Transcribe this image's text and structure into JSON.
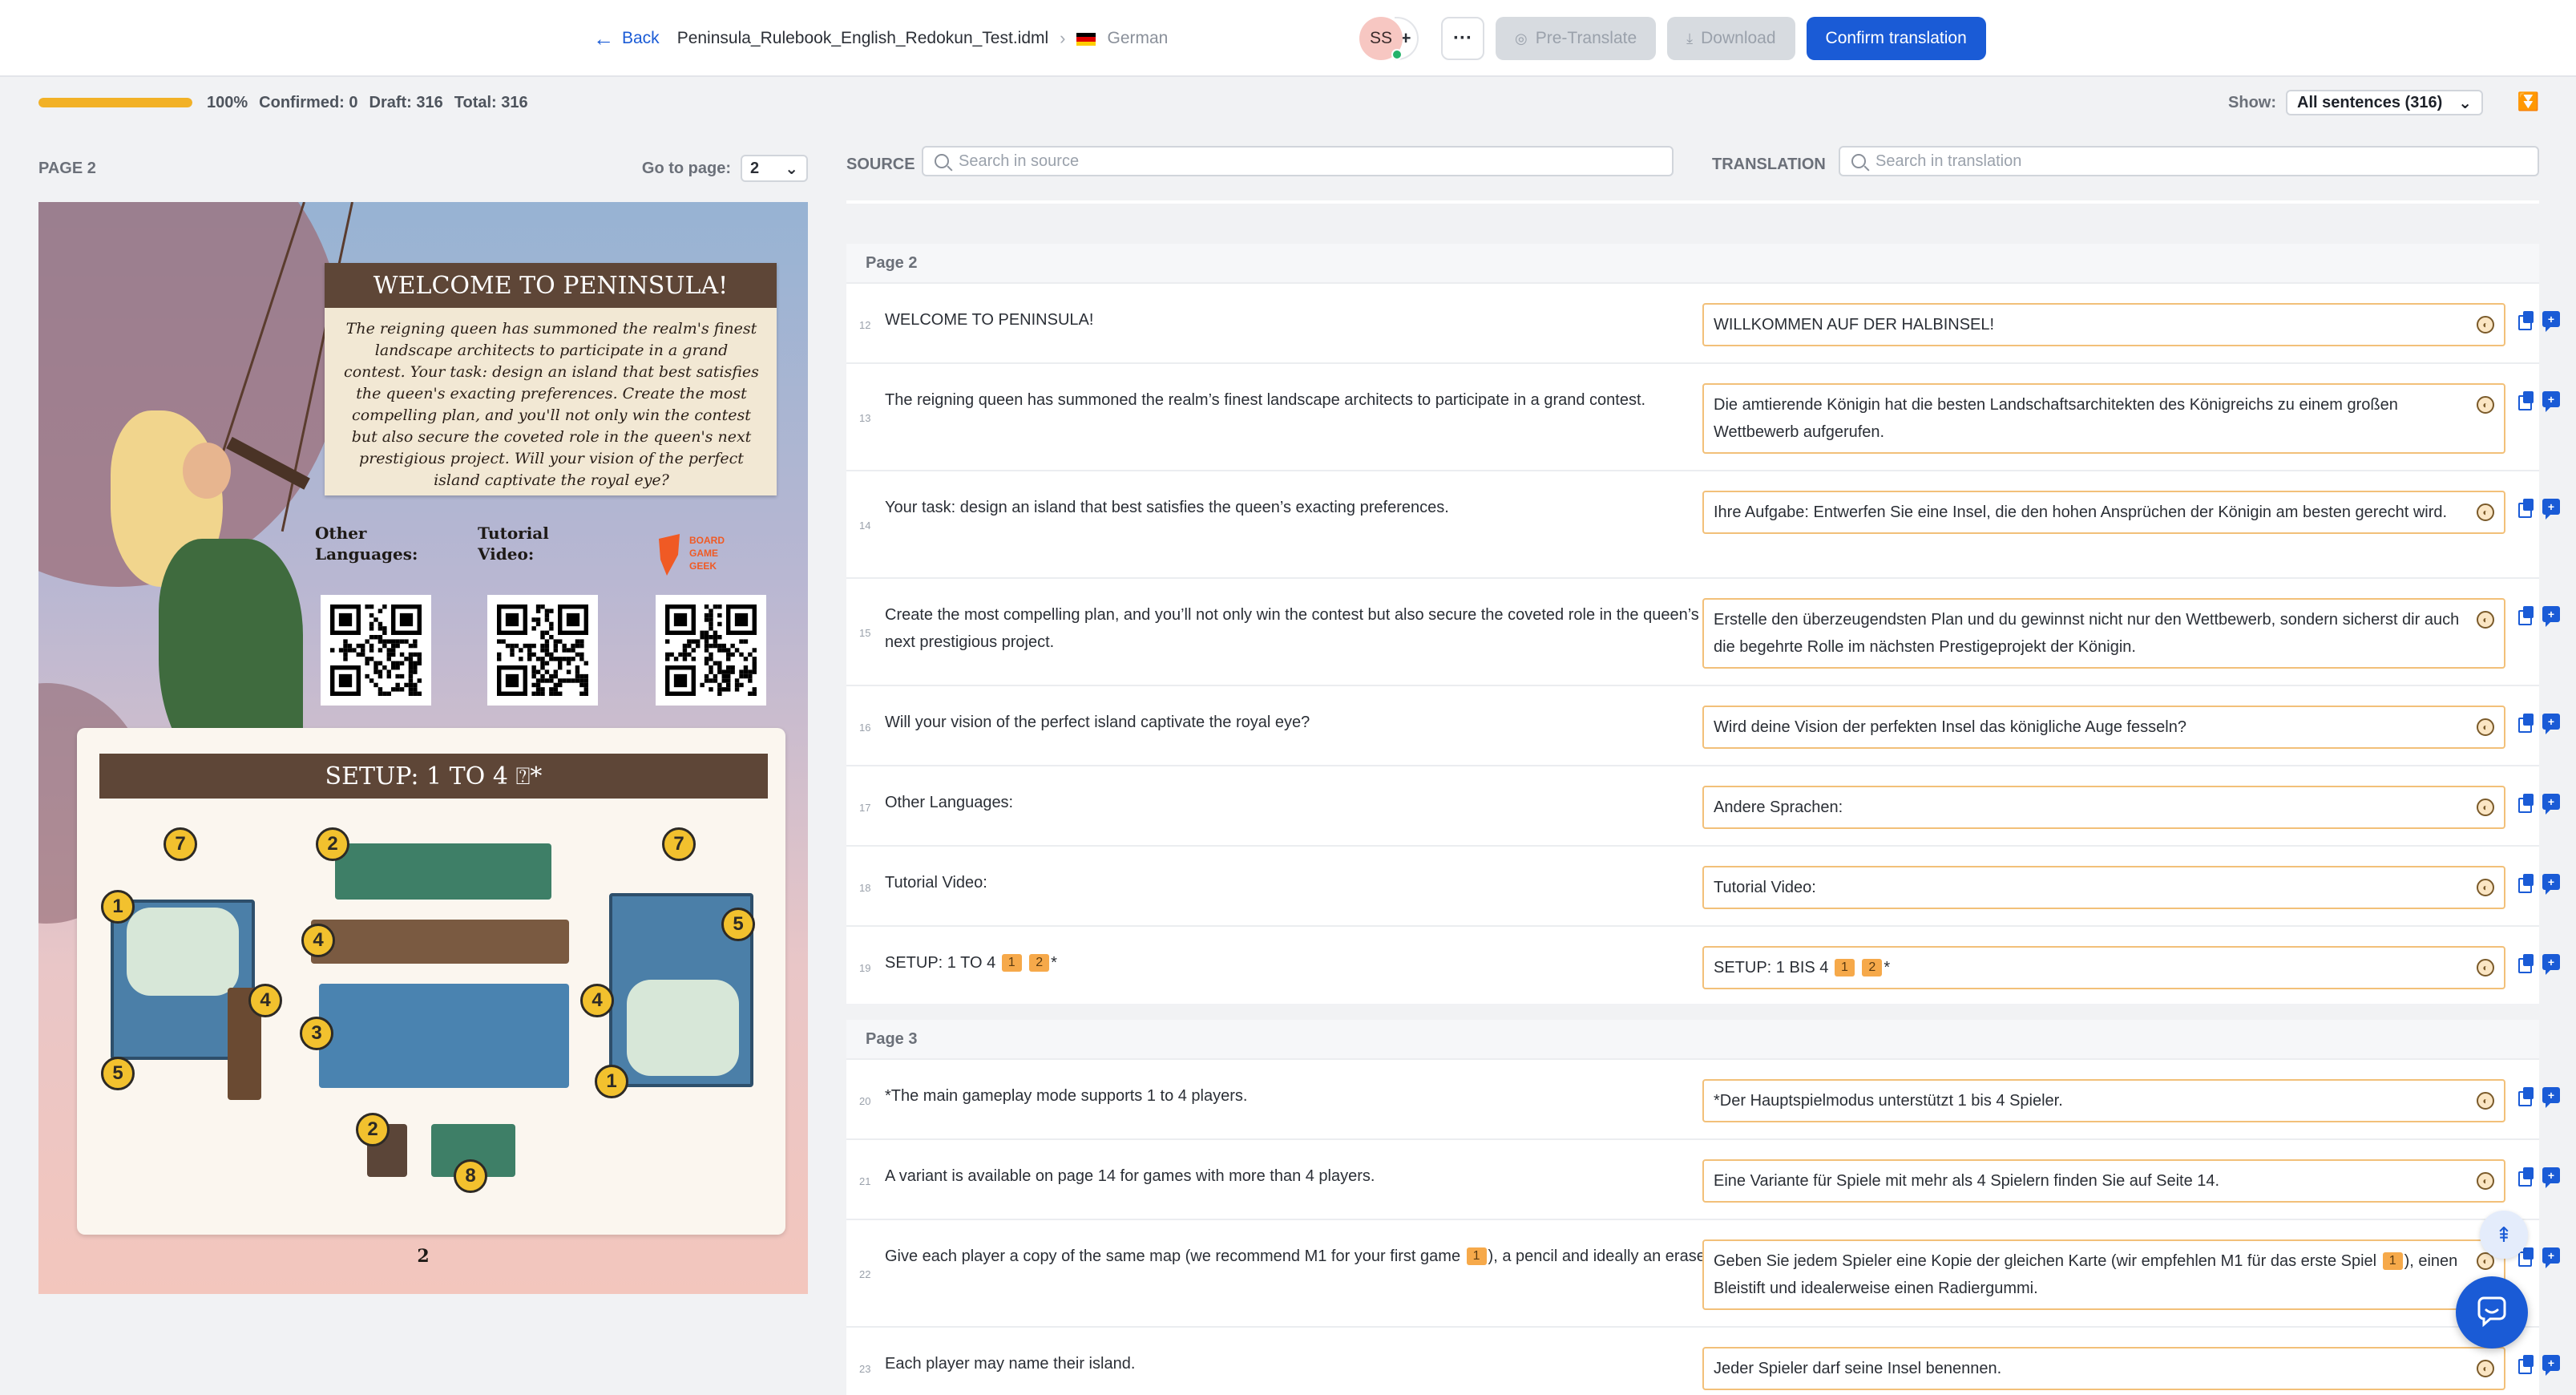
{
  "header": {
    "back_label": "Back",
    "file_name": "Peninsula_Rulebook_English_Redokun_Test.idml",
    "target_language": "German",
    "avatar_initials": "SS",
    "avatar_add": "+",
    "more_label": "···",
    "pretranslate_label": "Pre-Translate",
    "download_label": "Download",
    "confirm_label": "Confirm translation"
  },
  "progress": {
    "fraction": 1.0,
    "percent_label": "100%",
    "confirmed": "Confirmed: 0",
    "draft": "Draft: 316",
    "total": "Total: 316"
  },
  "filter": {
    "show_label": "Show:",
    "show_value": "All sentences (316)"
  },
  "left_panel": {
    "page_label": "PAGE 2",
    "goto_label": "Go to page:",
    "goto_value": "2"
  },
  "preview": {
    "welcome_title": "WELCOME TO PENINSULA!",
    "welcome_text": "The reigning queen has summoned the realm's finest landscape architects to participate in a grand contest. Your task: design an island that best satisfies the queen's exacting preferences. Create the most compelling plan, and you'll not only win the contest but also secure the coveted role in the queen's next prestigious project. Will your vision of the perfect island captivate the royal eye?",
    "other_languages": "Other Languages:",
    "tutorial_video": "Tutorial Video:",
    "bgg_logo_text": "BOARD GAME GEEK",
    "setup_title": "SETUP: 1 TO 4 ⍰*",
    "page_number": "2"
  },
  "right_panel": {
    "source_label": "SOURCE",
    "source_placeholder": "Search in source",
    "translation_label": "TRANSLATION",
    "translation_placeholder": "Search in translation"
  },
  "sections": [
    {
      "title": "Page 2",
      "rows": [
        {
          "num": "12",
          "source": "WELCOME TO PENINSULA!",
          "target": "WILLKOMMEN AUF DER HALBINSEL!"
        },
        {
          "num": "13",
          "source": "The reigning queen has summoned the realm’s finest landscape architects to participate in a grand contest.",
          "target": "Die amtierende Königin hat die besten Landschaftsarchitekten des Königreichs zu einem großen Wettbewerb aufgerufen."
        },
        {
          "num": "14",
          "source": "Your task: design an island that best satisfies the queen’s exacting preferences.",
          "target": "Ihre Aufgabe: Entwerfen Sie eine Insel, die den hohen Ansprüchen der Königin am besten gerecht wird."
        },
        {
          "num": "15",
          "source": "Create the most compelling plan, and you’ll not only win the contest but also secure the coveted role in the queen’s next prestigious project.",
          "target": "Erstelle den überzeugendsten Plan und du gewinnst nicht nur den Wettbewerb, sondern sicherst dir auch die begehrte Rolle im nächsten Prestigeprojekt der Königin."
        },
        {
          "num": "16",
          "source": "Will your vision of the perfect island captivate the royal eye?",
          "target": "Wird deine Vision der perfekten Insel das königliche Auge fesseln?"
        },
        {
          "num": "17",
          "source": "Other Languages:",
          "target": "Andere Sprachen:"
        },
        {
          "num": "18",
          "source": "Tutorial Video:",
          "target": "Tutorial Video:"
        },
        {
          "num": "19",
          "source_pre": "SETUP: 1 TO 4",
          "tag1": "1",
          "tag2": "2",
          "source_post": "*",
          "target_pre": "SETUP: 1 BIS 4",
          "target_post": "*"
        }
      ]
    },
    {
      "title": "Page 3",
      "rows": [
        {
          "num": "20",
          "source": "*The main gameplay mode supports 1 to 4 players.",
          "target": "*Der Hauptspielmodus unterstützt 1 bis 4 Spieler."
        },
        {
          "num": "21",
          "source": "A variant is available on page 14 for games with more than 4 players.",
          "target": "Eine Variante für Spiele mit mehr als 4 Spielern finden Sie auf Seite 14."
        },
        {
          "num": "22",
          "source_pre": "Give each player a copy of the same map (we recommend M1 for your first game",
          "tag1": "1",
          "source_post": "), a pencil and ideally an eraser.",
          "target_pre": "Geben Sie jedem Spieler eine Kopie der gleichen Karte (wir empfehlen M1 für das erste Spiel",
          "target_post": "), einen Bleistift und idealerweise einen Radiergummi."
        },
        {
          "num": "23",
          "source": "Each player may name their island.",
          "target": "Jeder Spieler darf seine Insel benennen."
        }
      ]
    }
  ],
  "colors": {
    "accent": "#1a5bd6",
    "progress": "#f2b126",
    "tag": "#f6a94a",
    "target_border": "#f2c079"
  },
  "icons": [
    "back-arrow-icon",
    "flag-germany-icon",
    "pretranslate-icon",
    "download-icon",
    "chevron-down-icon",
    "filter-icon",
    "search-icon",
    "status-icon",
    "copy-icon",
    "comment-icon",
    "scroll-top-icon",
    "chat-icon"
  ]
}
